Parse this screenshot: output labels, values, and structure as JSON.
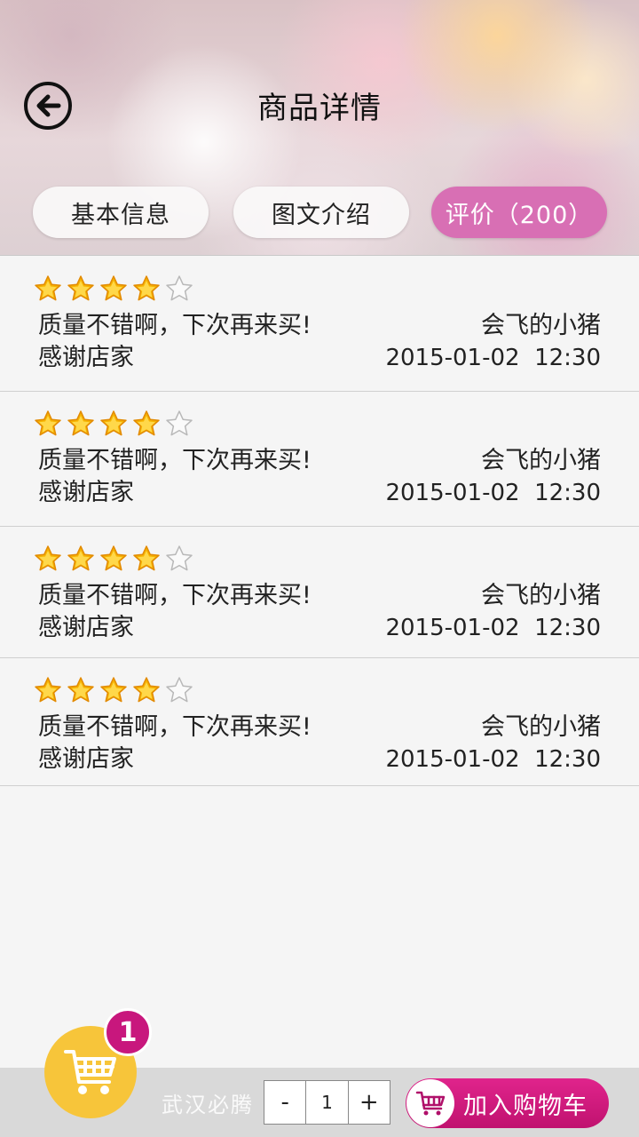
{
  "header": {
    "title": "商品详情",
    "tabs": [
      {
        "label": "基本信息"
      },
      {
        "label": "图文介绍"
      },
      {
        "label": "评价（200）"
      }
    ]
  },
  "reviews": [
    {
      "rating": 4,
      "max": 5,
      "comment": "质量不错啊，下次再来买!",
      "comment_line2": "感谢店家",
      "user": "会飞的小猪",
      "time": "2015-01-02  12:30"
    },
    {
      "rating": 4,
      "max": 5,
      "comment": "质量不错啊，下次再来买!",
      "comment_line2": "感谢店家",
      "user": "会飞的小猪",
      "time": "2015-01-02  12:30"
    },
    {
      "rating": 4,
      "max": 5,
      "comment": "质量不错啊，下次再来买!",
      "comment_line2": "感谢店家",
      "user": "会飞的小猪",
      "time": "2015-01-02  12:30"
    },
    {
      "rating": 4,
      "max": 5,
      "comment": "质量不错啊，下次再来买!",
      "comment_line2": "感谢店家",
      "user": "会飞的小猪",
      "time": "2015-01-02  12:30"
    }
  ],
  "bottom": {
    "cart_count": "1",
    "watermark": "武汉必腾",
    "qty_minus": "-",
    "qty_value": "1",
    "qty_plus": "+",
    "add_to_cart": "加入购物车"
  },
  "colors": {
    "accent_tab": "#d86fb4",
    "add_button": "#d01a80",
    "cart_circle": "#f7c53a",
    "badge": "#c8177d"
  },
  "icons": {
    "back": "back-arrow-circle-icon",
    "star_full": "star-filled-icon",
    "star_empty": "star-empty-icon",
    "cart": "shopping-cart-icon"
  }
}
